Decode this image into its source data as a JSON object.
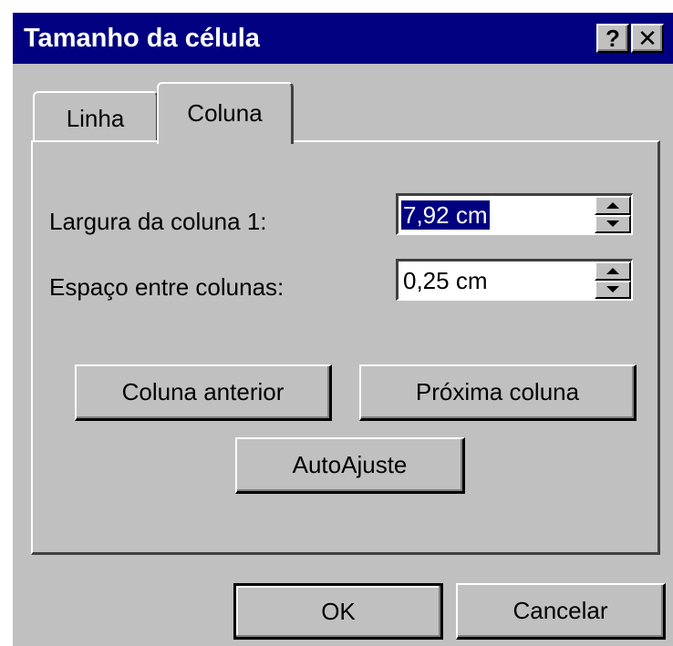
{
  "dialog": {
    "title": "Tamanho da célula",
    "help_glyph": "?",
    "close_glyph": "✕",
    "tabs": [
      {
        "label": "Linha",
        "active": false
      },
      {
        "label": "Coluna",
        "active": true
      }
    ],
    "fields": {
      "largura": {
        "label": "Largura da coluna 1:",
        "value": "7,92 cm",
        "selected": true
      },
      "espaco": {
        "label": "Espaço entre colunas:",
        "value": "0,25 cm",
        "selected": false
      }
    },
    "buttons": {
      "coluna_anterior": "Coluna anterior",
      "proxima_coluna": "Próxima coluna",
      "autoajuste": "AutoAjuste",
      "ok": "OK",
      "cancelar": "Cancelar"
    }
  },
  "colors": {
    "face": "#c0c0c0",
    "titlebar": "#000080",
    "selection": "#000080"
  }
}
